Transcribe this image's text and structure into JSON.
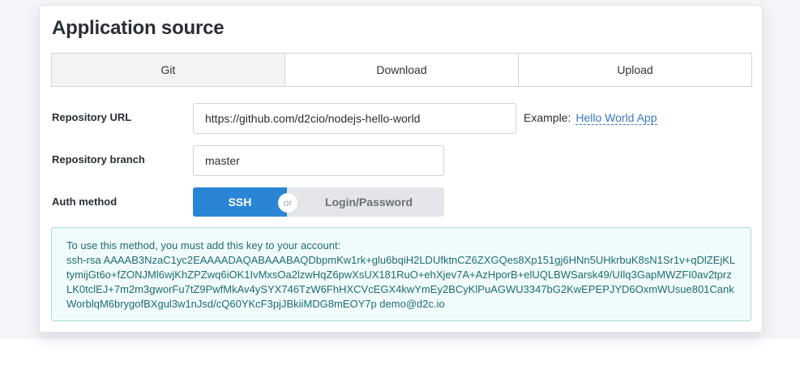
{
  "section": {
    "title": "Application source"
  },
  "tabs": [
    {
      "label": "Git",
      "active": true
    },
    {
      "label": "Download",
      "active": false
    },
    {
      "label": "Upload",
      "active": false
    }
  ],
  "repository_url": {
    "label": "Repository URL",
    "value": "https://github.com/d2cio/nodejs-hello-world",
    "example_prefix": "Example:",
    "example_link": "Hello World App"
  },
  "repository_branch": {
    "label": "Repository branch",
    "value": "master"
  },
  "auth_method": {
    "label": "Auth method",
    "options": [
      "SSH",
      "Login/Password"
    ],
    "selected": "SSH",
    "separator": "or"
  },
  "ssh_key": {
    "instruction": "To use this method, you must add this key to your account:",
    "key": "ssh-rsa AAAAB3NzaC1yc2EAAAADAQABAAABAQDbpmKw1rk+glu6bqiH2LDUfktnCZ6ZXGQes8Xp151gj6HNn5UHkrbuK8sN1Sr1v+qDlZEjKLtymijGt6o+fZONJMl6wjKhZPZwq6iOK1IvMxsOa2lzwHqZ6pwXsUX181RuO+ehXjev7A+AzHporB+elUQLBWSarsk49/UIlq3GapMWZFI0av2tprzLK0tclEJ+7m2m3gworFu7tZ9PwfMkAv4ySYX746TzW6FhHXCVcEGX4kwYmEy2BCyKlPuAGWU3347bG2KwEPEPJYD6OxmWUsue801CankWorblqM6brygofBXgul3w1nJsd/cQ60YKcF3pjJBkiiMDG8mEOY7p demo@d2c.io"
  },
  "colors": {
    "accent": "#2a86d4",
    "info_bg": "#f0fcfc",
    "info_text": "#1f6b73",
    "link": "#3a7bbf"
  }
}
